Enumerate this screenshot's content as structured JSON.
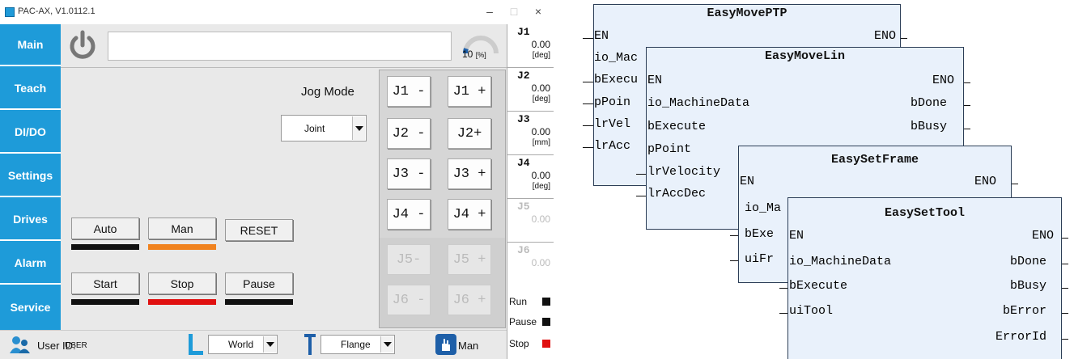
{
  "window": {
    "title": "PAC-AX, V1.0112.1",
    "minimize": "–",
    "maximize": "□",
    "close": "×"
  },
  "sidebar": {
    "items": [
      {
        "label": "Main"
      },
      {
        "label": "Teach"
      },
      {
        "label": "DI/DO"
      },
      {
        "label": "Settings"
      },
      {
        "label": "Drives"
      },
      {
        "label": "Alarm"
      },
      {
        "label": "Service"
      }
    ]
  },
  "topbar": {
    "speed_value": "10",
    "speed_unit": "[%]",
    "speed_fraction": 0.1
  },
  "jog": {
    "mode_label": "Jog Mode",
    "mode_value": "Joint",
    "buttons": [
      {
        "minus": "J1 -",
        "plus": "J1 +"
      },
      {
        "minus": "J2 -",
        "plus": "J2+"
      },
      {
        "minus": "J3 -",
        "plus": "J3 +"
      },
      {
        "minus": "J4 -",
        "plus": "J4 +"
      },
      {
        "minus": "J5-",
        "plus": "J5 +"
      },
      {
        "minus": "J6 -",
        "plus": "J6 +"
      }
    ]
  },
  "controls": {
    "auto": "Auto",
    "man": "Man",
    "reset": "RESET",
    "start": "Start",
    "stop": "Stop",
    "pause": "Pause"
  },
  "axes": [
    {
      "name": "J1",
      "value": "0.00",
      "unit": "[deg]"
    },
    {
      "name": "J2",
      "value": "0.00",
      "unit": "[deg]"
    },
    {
      "name": "J3",
      "value": "0.00",
      "unit": "[mm]"
    },
    {
      "name": "J4",
      "value": "0.00",
      "unit": "[deg]"
    },
    {
      "name": "J5",
      "value": "0.00",
      "unit": ""
    },
    {
      "name": "J6",
      "value": "0.00",
      "unit": ""
    }
  ],
  "status": {
    "run": "Run",
    "pause": "Pause",
    "stop": "Stop"
  },
  "bottombar": {
    "user_label": "User ID:",
    "user_value": "USER",
    "frame": "World",
    "tool": "Flange",
    "mode": "Man"
  },
  "colors": {
    "accent": "#1e9bd9",
    "stop": "#e01010",
    "man": "#f0821e"
  },
  "blocks": {
    "ptp": {
      "title": "EasyMovePTP",
      "left_pins": [
        "EN",
        "io_Mac",
        "bExecu",
        "pPoin",
        "lrVel",
        "lrAcc"
      ],
      "right_pins": [
        "ENO"
      ]
    },
    "lin": {
      "title": "EasyMoveLin",
      "left_pins": [
        "EN",
        "io_MachineData",
        "bExecute",
        "pPoint",
        "lrVelocity",
        "lrAccDec"
      ],
      "right_pins": [
        "ENO",
        "bDone",
        "bBusy"
      ]
    },
    "frame": {
      "title": "EasySetFrame",
      "left_pins": [
        "EN",
        "io_Ma",
        "bExe",
        "uiFr"
      ],
      "right_pins": [
        "ENO"
      ]
    },
    "tool": {
      "title": "EasySetTool",
      "left_pins": [
        "EN",
        "io_MachineData",
        "bExecute",
        "uiTool"
      ],
      "right_pins": [
        "ENO",
        "bDone",
        "bBusy",
        "bError",
        "ErrorId"
      ]
    }
  }
}
